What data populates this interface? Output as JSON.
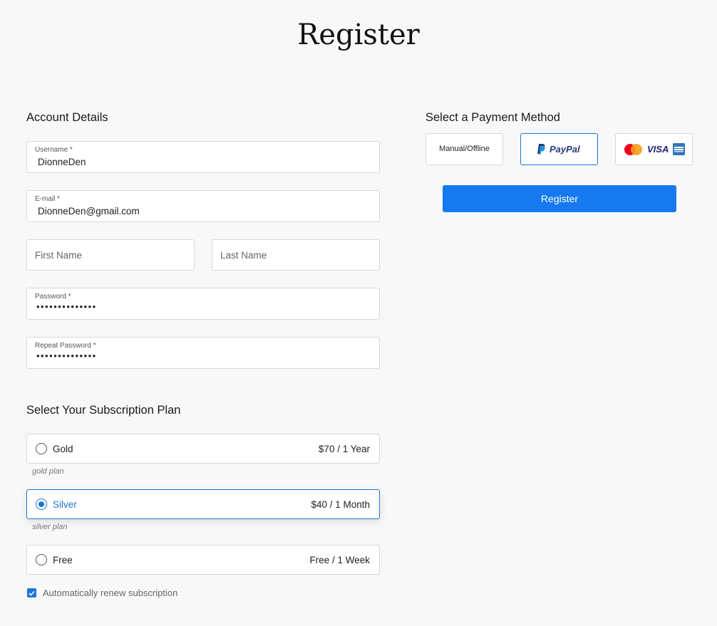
{
  "page": {
    "title": "Register"
  },
  "account": {
    "heading": "Account Details",
    "username": {
      "label": "Username *",
      "value": "DionneDen"
    },
    "email": {
      "label": "E-mail *",
      "value": "DionneDen@gmail.com"
    },
    "first_name": {
      "placeholder": "First Name"
    },
    "last_name": {
      "placeholder": "Last Name"
    },
    "password": {
      "label": "Password *",
      "value": "••••••••••••••"
    },
    "repeat_password": {
      "label": "Repeat Password *",
      "value": "••••••••••••••"
    }
  },
  "subscription": {
    "heading": "Select Your Subscription Plan",
    "plans": [
      {
        "name": "Gold",
        "price": "$70 / 1 Year",
        "description": "gold plan",
        "selected": false
      },
      {
        "name": "Silver",
        "price": "$40 / 1 Month",
        "description": "silver plan",
        "selected": true
      },
      {
        "name": "Free",
        "price": "Free / 1 Week",
        "description": "",
        "selected": false
      }
    ],
    "auto_renew": {
      "label": "Automatically renew subscription",
      "checked": true
    }
  },
  "payment": {
    "heading": "Select a Payment Method",
    "methods": [
      {
        "label": "Manual/Offline",
        "selected": false
      },
      {
        "label": "PayPal",
        "selected": true
      },
      {
        "label": "VISA",
        "selected": false
      }
    ],
    "register_label": "Register"
  },
  "colors": {
    "accent": "#1779f0",
    "selected_border": "#1a76d8",
    "paypal_dark": "#253b80",
    "paypal_light": "#179bd7",
    "visa_blue": "#1a1f71",
    "mastercard_red": "#eb001b",
    "mastercard_orange": "#f79e1b",
    "amex_blue": "#2e77bc"
  }
}
